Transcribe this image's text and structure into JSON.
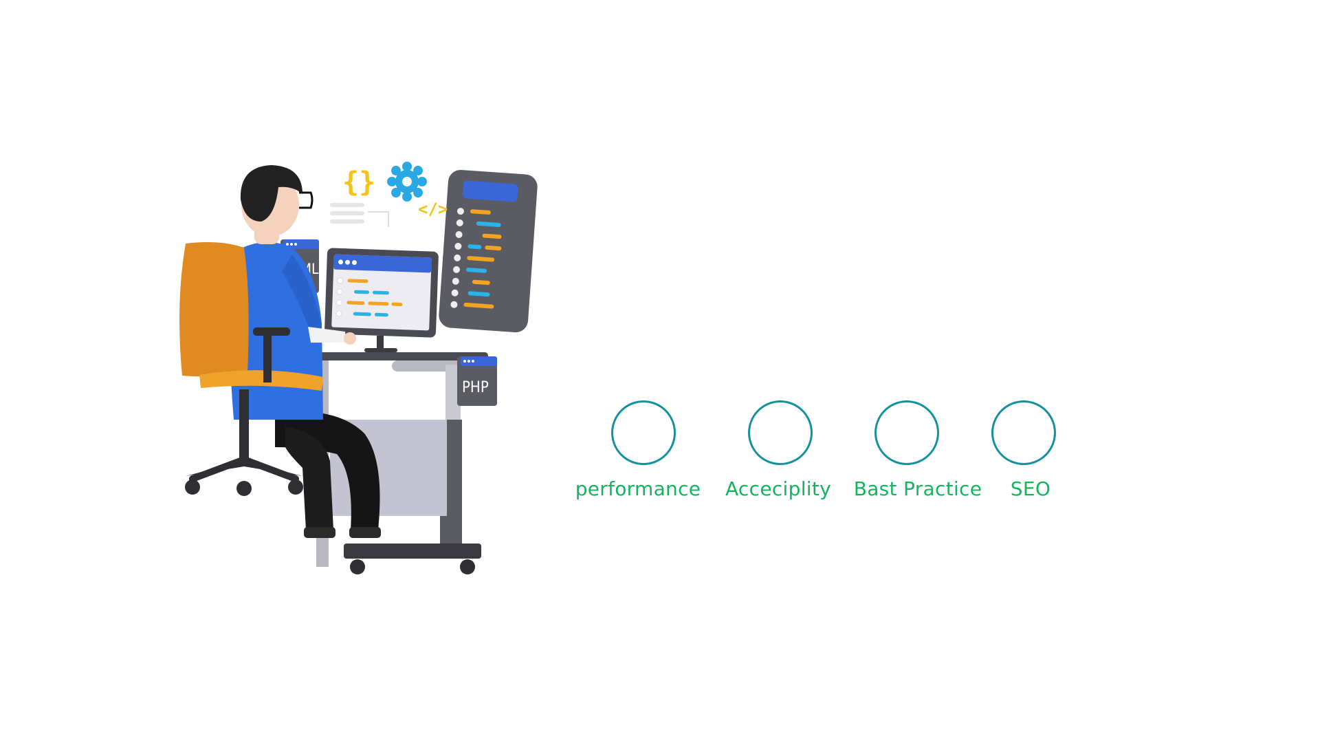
{
  "illustration": {
    "subject": "developer-at-desk",
    "icons": [
      "curly-braces-icon",
      "gear-icon",
      "code-tag-icon"
    ],
    "window_labels": {
      "html": "HTML",
      "php": "PHP"
    }
  },
  "metrics": [
    {
      "label": "performance"
    },
    {
      "label": "Acceciplity"
    },
    {
      "label": "Bast Practice"
    },
    {
      "label": "SEO"
    }
  ],
  "colors": {
    "ring": "#13919e",
    "label": "#13b55c",
    "shirt": "#2f6fe0",
    "chair": "#e88a1e",
    "window_header": "#3a66d8",
    "code_orange": "#f2a31f",
    "code_blue": "#29b3e6"
  }
}
